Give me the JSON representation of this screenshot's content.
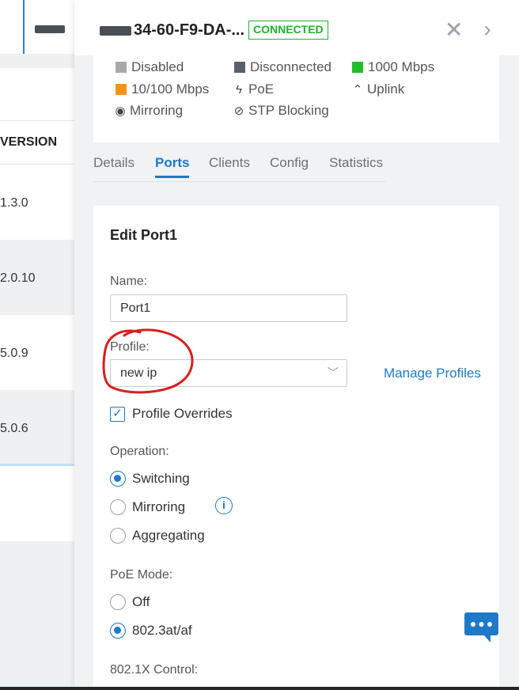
{
  "background": {
    "table_header": "VERSION",
    "rows": [
      "1.3.0",
      "2.0.10",
      "5.0.9",
      "5.0.6"
    ]
  },
  "header": {
    "title": "34-60-F9-DA-...",
    "status_badge": "CONNECTED",
    "icons": [
      "switch-device-icon",
      "close-icon",
      "chevron-right-icon"
    ]
  },
  "legend": [
    {
      "label": "Disabled",
      "kind": "swatch",
      "color": "#a6a9ac"
    },
    {
      "label": "Disconnected",
      "kind": "swatch",
      "color": "#5a6068"
    },
    {
      "label": "1000 Mbps",
      "kind": "swatch",
      "color": "#1fbf2a"
    },
    {
      "label": "10/100 Mbps",
      "kind": "swatch",
      "color": "#f5941d"
    },
    {
      "label": "PoE",
      "kind": "glyph",
      "icon": "bolt-icon",
      "glyph": "ϟ"
    },
    {
      "label": "Uplink",
      "kind": "glyph",
      "icon": "caret-up-icon",
      "glyph": "⌃"
    },
    {
      "label": "Mirroring",
      "kind": "glyph",
      "icon": "eye-icon",
      "glyph": "◉"
    },
    {
      "label": "STP Blocking",
      "kind": "glyph",
      "icon": "blocked-icon",
      "glyph": "⊘"
    }
  ],
  "tabs": [
    {
      "label": "Details",
      "active": false
    },
    {
      "label": "Ports",
      "active": true
    },
    {
      "label": "Clients",
      "active": false
    },
    {
      "label": "Config",
      "active": false
    },
    {
      "label": "Statistics",
      "active": false
    }
  ],
  "edit_port": {
    "title": "Edit Port1",
    "name_label": "Name:",
    "name_value": "Port1",
    "profile_label": "Profile:",
    "profile_value": "new ip",
    "manage_profiles": "Manage Profiles",
    "profile_overrides_label": "Profile Overrides",
    "profile_overrides_checked": true,
    "operation_label": "Operation:",
    "operation_options": [
      {
        "label": "Switching",
        "selected": true
      },
      {
        "label": "Mirroring",
        "selected": false
      },
      {
        "label": "Aggregating",
        "selected": false
      }
    ],
    "poe_label": "PoE Mode:",
    "poe_options": [
      {
        "label": "Off",
        "selected": false
      },
      {
        "label": "802.3at/af",
        "selected": true
      }
    ],
    "dot1x_label": "802.1X Control:"
  },
  "colors": {
    "accent": "#1f78c8",
    "connected": "#1fb02f",
    "annotation": "#d81e1e"
  }
}
